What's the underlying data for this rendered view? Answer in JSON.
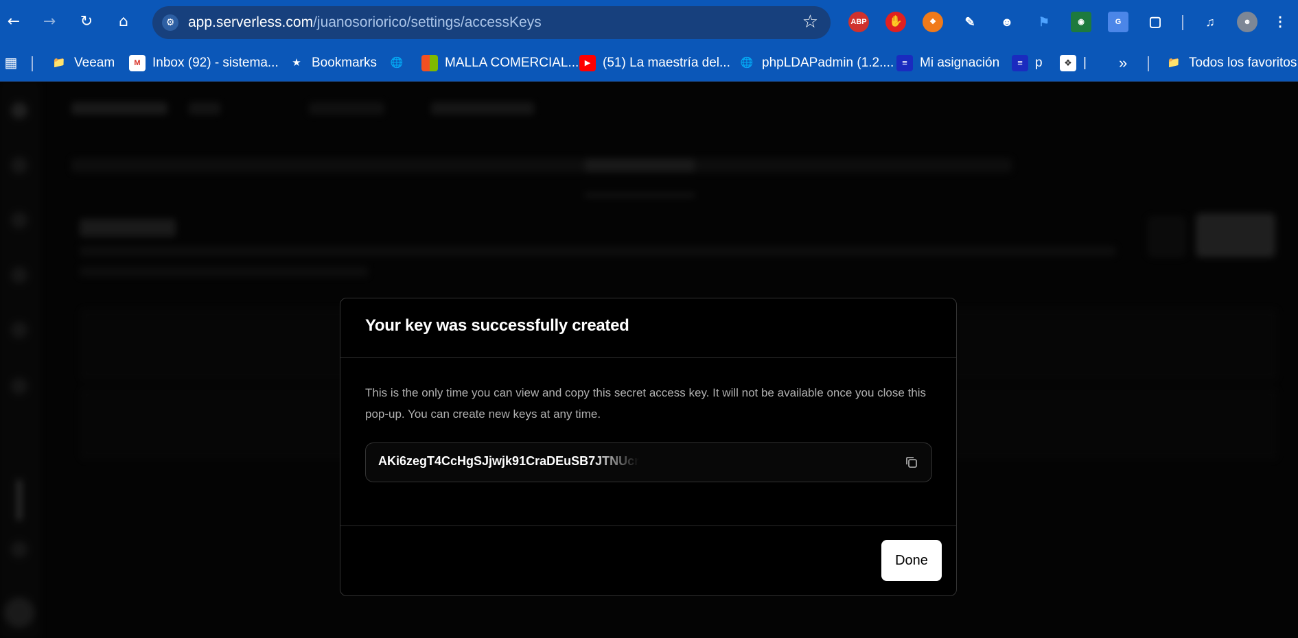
{
  "browser": {
    "url_host": "app.serverless.com",
    "url_path": "/juanosoriorico/settings/accessKeys",
    "extensions": [
      "adblock-icon",
      "stop-hand-icon",
      "orange-ext-icon",
      "eyedropper-icon",
      "ghostery-icon",
      "tag-icon",
      "photo-ext-icon",
      "translate-icon",
      "puzzle-icon",
      "media-icon",
      "profile-avatar"
    ],
    "bookmarks": [
      {
        "label": "Veeam",
        "icon": "folder-icon"
      },
      {
        "label": "Inbox (92) - sistema...",
        "icon": "gmail-icon"
      },
      {
        "label": "Bookmarks",
        "icon": "star-icon"
      },
      {
        "label": "",
        "icon": "globe-icon"
      },
      {
        "label": "MALLA COMERCIAL...",
        "icon": "microsoft-icon"
      },
      {
        "label": "(51) La maestría del...",
        "icon": "youtube-icon"
      },
      {
        "label": "phpLDAPadmin (1.2....",
        "icon": "globe-icon"
      },
      {
        "label": "Mi asignación",
        "icon": "doc-icon"
      },
      {
        "label": "p",
        "icon": "doc-icon"
      },
      {
        "label": "|",
        "icon": "link-icon"
      }
    ],
    "bookmarks_more": "»",
    "all_bookmarks": "Todos los favoritos"
  },
  "modal": {
    "title": "Your key was successfully created",
    "body": "This is the only time you can view and copy this secret access key. It will not be available once you close this pop-up. You can create new keys at any time.",
    "key": "AKi6zegT4CcHgSJjwjk91CraDEuSB7JTNUcn",
    "done_label": "Done"
  }
}
